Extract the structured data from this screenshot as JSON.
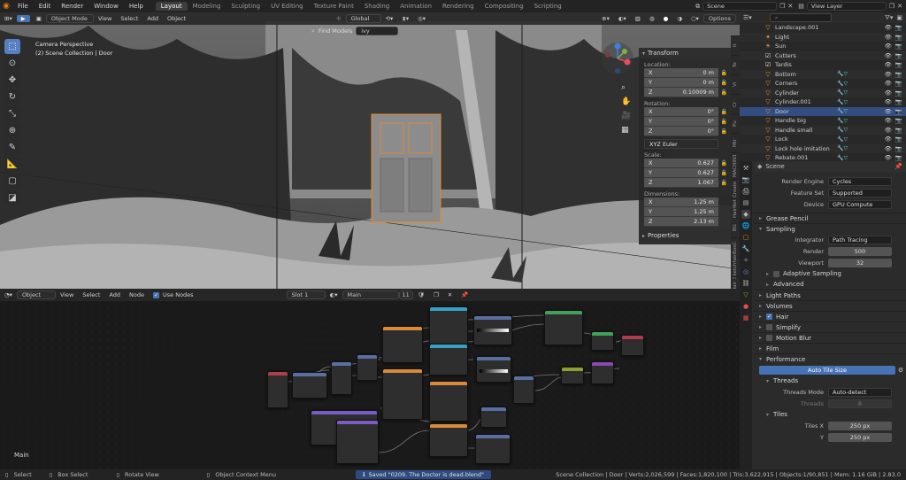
{
  "topbar": {
    "menus": [
      "File",
      "Edit",
      "Render",
      "Window",
      "Help"
    ],
    "workspaces": [
      {
        "label": "Layout",
        "active": true
      },
      {
        "label": "Modeling",
        "active": false
      },
      {
        "label": "Sculpting",
        "active": false
      },
      {
        "label": "UV Editing",
        "active": false
      },
      {
        "label": "Texture Paint",
        "active": false
      },
      {
        "label": "Shading",
        "active": false
      },
      {
        "label": "Animation",
        "active": false
      },
      {
        "label": "Rendering",
        "active": false
      },
      {
        "label": "Compositing",
        "active": false
      },
      {
        "label": "Scripting",
        "active": false
      }
    ],
    "scene_name": "Scene",
    "view_layer": "View Layer"
  },
  "viewport": {
    "mode": "Object Mode",
    "menus": [
      "View",
      "Select",
      "Add",
      "Object"
    ],
    "orientation": "Global",
    "find_models_label": "Find Models",
    "search_value": "ivy",
    "options_label": "Options",
    "info_line1": "Camera Perspective",
    "info_line2": "(2) Scene Collection | Door",
    "side_tabs": [
      "It",
      "To",
      "Vi",
      "Cr",
      "Pu",
      "Mtr",
      "MACHIN3",
      "Create",
      "HairNet",
      "BG",
      "BoxC",
      "Sketchfab",
      "Hair",
      "BTT",
      "Blen"
    ]
  },
  "npanel": {
    "title": "Transform",
    "location_label": "Location:",
    "location": [
      {
        "axis": "X",
        "value": "0 m"
      },
      {
        "axis": "Y",
        "value": "0 m"
      },
      {
        "axis": "Z",
        "value": "0.10009 m"
      }
    ],
    "rotation_label": "Rotation:",
    "rotation": [
      {
        "axis": "X",
        "value": "0°"
      },
      {
        "axis": "Y",
        "value": "0°"
      },
      {
        "axis": "Z",
        "value": "0°"
      }
    ],
    "rotation_mode": "XYZ Euler",
    "scale_label": "Scale:",
    "scale": [
      {
        "axis": "X",
        "value": "0.627"
      },
      {
        "axis": "Y",
        "value": "0.627"
      },
      {
        "axis": "Z",
        "value": "1.067"
      }
    ],
    "dimensions_label": "Dimensions:",
    "dimensions": [
      {
        "axis": "X",
        "value": "1.25 m"
      },
      {
        "axis": "Y",
        "value": "1.25 m"
      },
      {
        "axis": "Z",
        "value": "2.13 m"
      }
    ],
    "properties_label": "Properties"
  },
  "node_editor": {
    "type": "Object",
    "menus": [
      "View",
      "Select",
      "Add",
      "Node"
    ],
    "use_nodes_label": "Use Nodes",
    "slot": "Slot 1",
    "material": "Main",
    "user_count": "11",
    "frame_label": "Main"
  },
  "outliner": {
    "items": [
      {
        "name": "Landscape.001",
        "icon": "tri",
        "selected": false
      },
      {
        "name": "Light",
        "icon": "light",
        "selected": false
      },
      {
        "name": "Sun",
        "icon": "sun",
        "selected": false
      },
      {
        "name": "Cutters",
        "icon": "collection",
        "selected": false
      },
      {
        "name": "Tardis",
        "icon": "collection",
        "selected": false
      },
      {
        "name": "Bottom",
        "icon": "mesh",
        "selected": false
      },
      {
        "name": "Corners",
        "icon": "mesh",
        "selected": false
      },
      {
        "name": "Cylinder",
        "icon": "mesh",
        "selected": false
      },
      {
        "name": "Cylinder.001",
        "icon": "mesh",
        "selected": false
      },
      {
        "name": "Door",
        "icon": "mesh",
        "selected": true
      },
      {
        "name": "Handle big",
        "icon": "mesh",
        "selected": false
      },
      {
        "name": "Handle small",
        "icon": "mesh",
        "selected": false
      },
      {
        "name": "Lock",
        "icon": "mesh",
        "selected": false
      },
      {
        "name": "Lock hole imitation",
        "icon": "mesh",
        "selected": false
      },
      {
        "name": "Rebate.001",
        "icon": "mesh",
        "selected": false
      }
    ]
  },
  "properties": {
    "scene_label": "Scene",
    "render_engine_label": "Render Engine",
    "render_engine": "Cycles",
    "feature_set_label": "Feature Set",
    "feature_set": "Supported",
    "device_label": "Device",
    "device": "GPU Compute",
    "grease_pencil": "Grease Pencil",
    "sampling": "Sampling",
    "integrator_label": "Integrator",
    "integrator": "Path Tracing",
    "render_label": "Render",
    "render_samples": "500",
    "viewport_label": "Viewport",
    "viewport_samples": "32",
    "adaptive_sampling": "Adaptive Sampling",
    "advanced": "Advanced",
    "light_paths": "Light Paths",
    "volumes": "Volumes",
    "hair": "Hair",
    "simplify": "Simplify",
    "motion_blur": "Motion Blur",
    "film": "Film",
    "performance": "Performance",
    "auto_tile_size": "Auto Tile Size",
    "threads": "Threads",
    "threads_mode_label": "Threads Mode",
    "threads_mode": "Auto-detect",
    "threads_count_label": "Threads",
    "threads_count": "8",
    "tiles": "Tiles",
    "tiles_x_label": "Tiles X",
    "tiles_x": "250 px",
    "tiles_y_label": "Y",
    "tiles_y": "250 px"
  },
  "statusbar": {
    "select": "Select",
    "box_select": "Box Select",
    "rotate_view": "Rotate View",
    "context_menu": "Object Context Menu",
    "saved_message": "Saved \"0209. The Doctor is dead.blend\"",
    "stats": "Scene Collection | Door | Verts:2,026,599 | Faces:1,820,100 | Tris:3,622,915 | Objects:1/90,851 | Mem: 1.16 GiB | 2.83.0"
  }
}
